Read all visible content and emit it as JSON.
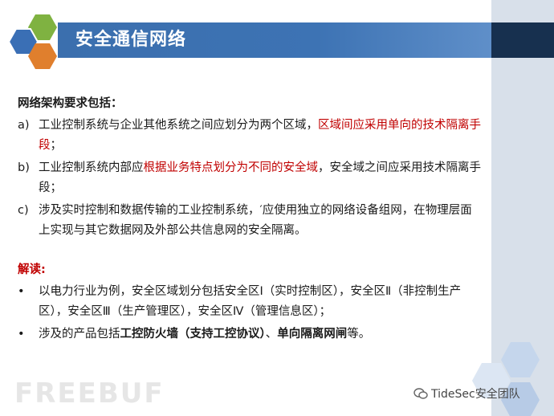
{
  "slide": {
    "title": "安全通信网络"
  },
  "section1": {
    "heading": "网络架构要求包括：",
    "items": [
      {
        "marker": "a)",
        "parts": [
          {
            "text": "工业控制系统与企业其他系统之间应划分为两个区域，",
            "style": "normal"
          },
          {
            "text": "区域间应采用单向的技术隔离手段",
            "style": "red"
          },
          {
            "text": "；",
            "style": "normal"
          }
        ]
      },
      {
        "marker": "b)",
        "parts": [
          {
            "text": "工业控制系统内部应",
            "style": "normal"
          },
          {
            "text": "根据业务特点划分为不同的安全域",
            "style": "red"
          },
          {
            "text": "，安全域之间应采用技术隔离手段；",
            "style": "normal"
          }
        ]
      },
      {
        "marker": "c)",
        "parts": [
          {
            "text": "涉及实时控制和数据传输的工业控制系统，′应使用独立的网络设备组网，在物理层面上实现与其它数据网及外部公共信息网的安全隔离。",
            "style": "normal"
          }
        ]
      }
    ]
  },
  "section2": {
    "heading": "解读:",
    "items": [
      {
        "marker": "•",
        "parts": [
          {
            "text": "以电力行业为例，安全区域划分包括安全区Ⅰ（实时控制区），安全区Ⅱ（非控制生产区），安全区Ⅲ（生产管理区），安全区Ⅳ（管理信息区）；",
            "style": "normal"
          }
        ]
      },
      {
        "marker": "•",
        "parts": [
          {
            "text": "涉及的产品包括",
            "style": "normal"
          },
          {
            "text": "工控防火墙（支持工控协议）",
            "style": "bold"
          },
          {
            "text": "、",
            "style": "normal"
          },
          {
            "text": "单向隔离网闸",
            "style": "bold"
          },
          {
            "text": "等。",
            "style": "normal"
          }
        ]
      }
    ]
  },
  "watermarks": {
    "left": "FREEBUF",
    "right": "TideSec安全团队"
  },
  "colors": {
    "title_bar": "#3d73b4",
    "accent_red": "#c00000",
    "hex_blue": "#3a6fb5",
    "hex_green": "#7fb241",
    "hex_orange": "#e07f2d"
  }
}
